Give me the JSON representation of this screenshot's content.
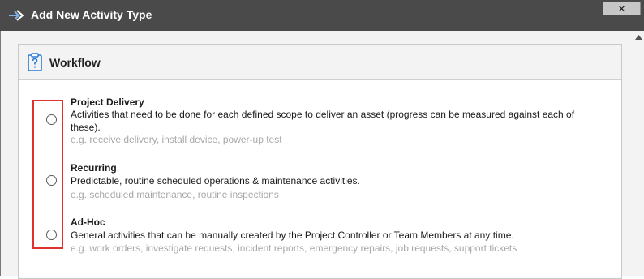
{
  "window": {
    "title": "Add New Activity Type",
    "app_icon": "plane-arrow-icon",
    "close_label": "✕"
  },
  "panel": {
    "title": "Workflow",
    "icon": "clipboard-question-icon"
  },
  "workflow_options": [
    {
      "title": "Project Delivery",
      "description": "Activities that need to be done for each defined scope to deliver an asset (progress can be measured against each of these).",
      "example": "e.g. receive delivery, install device, power-up test",
      "selected": false
    },
    {
      "title": "Recurring",
      "description": "Predictable, routine scheduled operations & maintenance activities.",
      "example": "e.g. scheduled maintenance, routine inspections",
      "selected": false
    },
    {
      "title": "Ad-Hoc",
      "description": "General activities that can be manually created by the Project Controller or Team Members at any time.",
      "example": "e.g. work orders, investigate requests, incident reports, emergency repairs, job requests, support tickets",
      "selected": false
    }
  ],
  "colors": {
    "titlebar": "#4a4a4a",
    "highlight": "#e0312f",
    "icon_accent": "#2b7bd6"
  }
}
